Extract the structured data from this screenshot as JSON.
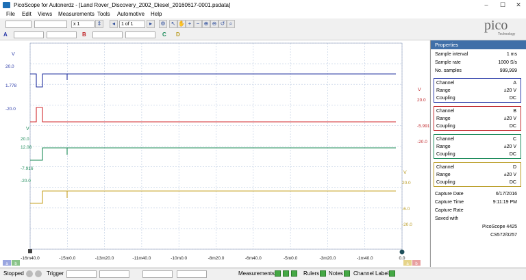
{
  "window": {
    "title": "PicoScope for Autonerdz - [Land Rover_Discovery_2002_Diesel_20160617-0001.psdata]",
    "controls": [
      "–",
      "☐",
      "✕"
    ]
  },
  "menu": [
    "File",
    "Edit",
    "Views",
    "Measurements",
    "Tools",
    "Automotive",
    "Help"
  ],
  "toolbar": {
    "zoom_value": "x 1",
    "buffer_value": "1 of 1",
    "channel_a": "A",
    "channel_b": "B",
    "channel_c": "C",
    "channel_d": "D"
  },
  "logo": {
    "word": "pico",
    "sub": "Technology"
  },
  "scope": {
    "y_axes": [
      {
        "unit": "V",
        "ticks": [
          "20.0",
          "1.778",
          "-20.0"
        ],
        "color": "#2a3aa8"
      },
      {
        "unit": "V",
        "ticks": [
          "20.0",
          "-5.991",
          "-20.0"
        ],
        "color": "#c0282c"
      },
      {
        "unit": "V",
        "ticks": [
          "20.0",
          "12.08",
          "-7.916",
          "-20.0"
        ],
        "color": "#1c8a5a"
      },
      {
        "unit": "V",
        "ticks": [
          "20.0",
          "-6.0",
          "-20.0"
        ],
        "color": "#b89a20"
      }
    ],
    "x_ticks": [
      "-16m40.0",
      "-15m0.0",
      "-13m20.0",
      "-11m40.0",
      "-10m0.0",
      "-8m20.0",
      "-6m40.0",
      "-5m0.0",
      "-3m20.0",
      "-1m40.0",
      "0.0"
    ],
    "bottom_left_labels": [
      "a",
      "b"
    ],
    "bottom_right_labels": [
      "a",
      "b"
    ],
    "traces": [
      {
        "channel": "A",
        "color": "#1f2f9e"
      },
      {
        "channel": "B",
        "color": "#d02a2e"
      },
      {
        "channel": "C",
        "color": "#1a8a55"
      },
      {
        "channel": "D",
        "color": "#c6a020"
      }
    ]
  },
  "properties": {
    "title": "Properties",
    "sample_interval_label": "Sample interval",
    "sample_interval": "1 ms",
    "sample_rate_label": "Sample rate",
    "sample_rate": "1000 S/s",
    "no_samples_label": "No. samples",
    "no_samples": "999,999",
    "channels": [
      {
        "channel_label": "Channel",
        "name": "A",
        "range_label": "Range",
        "range": "±20 V",
        "coupling_label": "Coupling",
        "coupling": "DC",
        "color": "#2a3aa8"
      },
      {
        "channel_label": "Channel",
        "name": "B",
        "range_label": "Range",
        "range": "±20 V",
        "coupling_label": "Coupling",
        "coupling": "DC",
        "color": "#c0282c"
      },
      {
        "channel_label": "Channel",
        "name": "C",
        "range_label": "Range",
        "range": "±20 V",
        "coupling_label": "Coupling",
        "coupling": "DC",
        "color": "#1c8a5a"
      },
      {
        "channel_label": "Channel",
        "name": "D",
        "range_label": "Range",
        "range": "±20 V",
        "coupling_label": "Coupling",
        "coupling": "DC",
        "color": "#b89a20"
      }
    ],
    "capture_date_label": "Capture Date",
    "capture_date": "6/17/2016",
    "capture_time_label": "Capture Time",
    "capture_time": "9:11:19 PM",
    "capture_rate_label": "Capture Rate",
    "capture_rate": "",
    "saved_with_label": "Saved with",
    "saved_with": "PicoScope 4425",
    "serial": "CS572/0257"
  },
  "statusbar": {
    "stopped": "Stopped",
    "trigger": "Trigger",
    "measurements": "Measurements",
    "rulers": "Rulers",
    "notes": "Notes",
    "channel_labels": "Channel Labels"
  }
}
